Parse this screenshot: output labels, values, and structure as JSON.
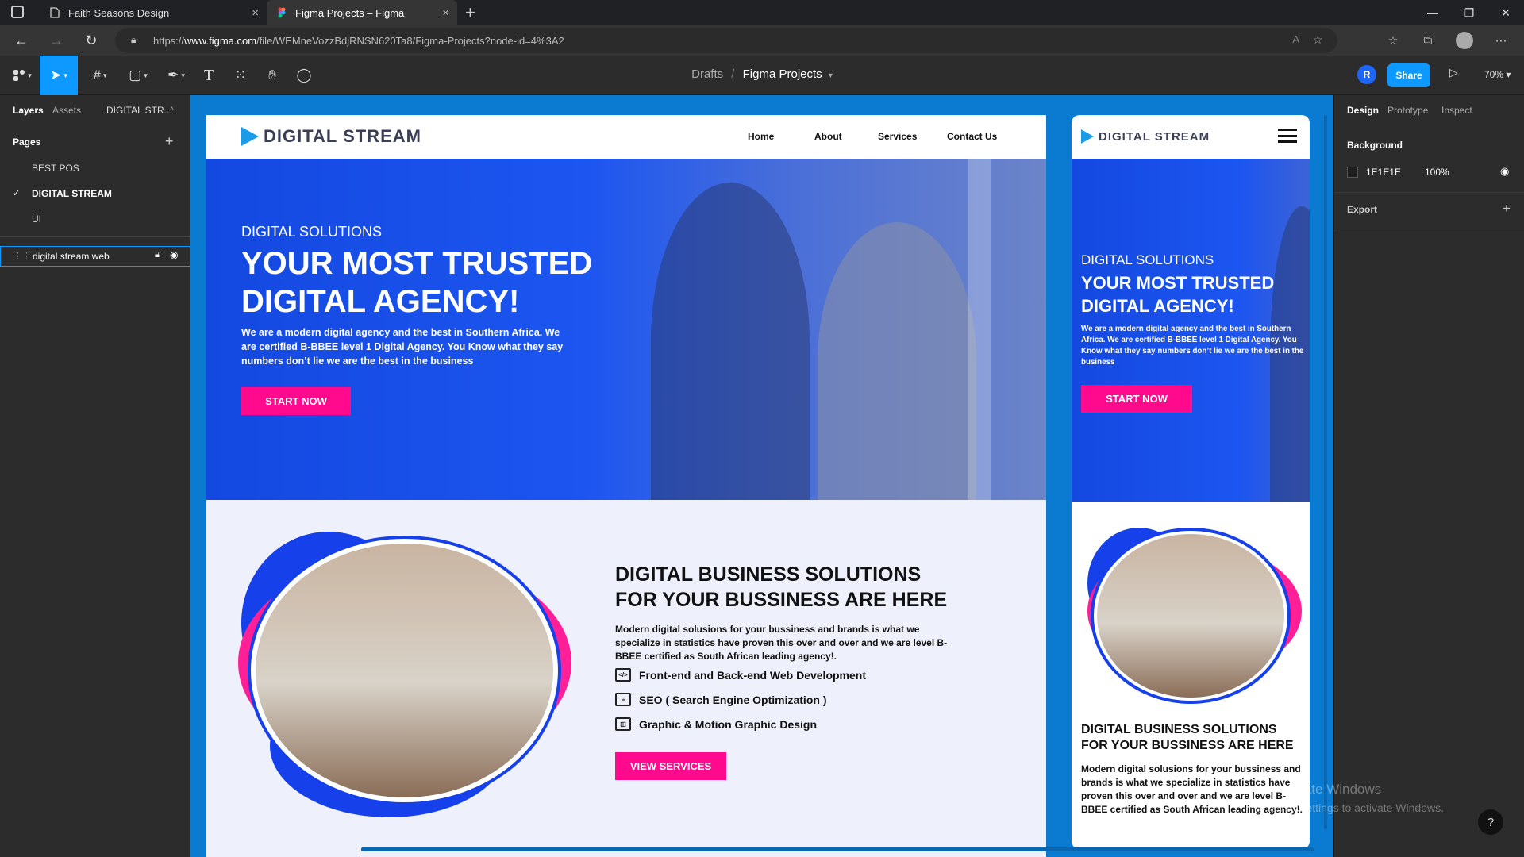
{
  "browser": {
    "tabs": [
      {
        "title": "Faith Seasons Design",
        "close": "×"
      },
      {
        "title": "Figma Projects – Figma",
        "close": "×"
      }
    ],
    "new_tab": "+",
    "url_prefix": "https://",
    "url_domain": "www.figma.com",
    "url_path": "/file/WEMneVozzBdjRNSN620Ta8/Figma-Projects?node-id=4%3A2",
    "window_controls": [
      "—",
      "❐",
      "✕"
    ]
  },
  "figma_toolbar": {
    "breadcrumb_parent": "Drafts",
    "breadcrumb_sep": "/",
    "breadcrumb_current": "Figma Projects",
    "avatar_initial": "R",
    "share_label": "Share",
    "zoom": "70%"
  },
  "left_panel": {
    "tabs": [
      "Layers",
      "Assets",
      "DIGITAL STR..."
    ],
    "pages_heading": "Pages",
    "pages": [
      "BEST POS",
      "DIGITAL STREAM",
      "UI"
    ],
    "selected_page": "DIGITAL STREAM",
    "layer_name": "digital stream web"
  },
  "right_panel": {
    "tabs": [
      "Design",
      "Prototype",
      "Inspect"
    ],
    "background_heading": "Background",
    "background_hex": "1E1E1E",
    "background_opacity": "100%",
    "export_heading": "Export"
  },
  "desktop": {
    "logo_text": "DIGITAL STREAM",
    "nav": [
      "Home",
      "About",
      "Services",
      "Contact Us"
    ],
    "hero_eyebrow": "DIGITAL SOLUTIONS",
    "hero_title_1": "YOUR MOST TRUSTED",
    "hero_title_2": "DIGITAL AGENCY!",
    "hero_body": "We are a modern digital agency and the best in Southern Africa. We are certified B-BBEE level 1 Digital Agency. You Know what they say numbers don’t lie we are the best in the business",
    "hero_cta": "START NOW",
    "sec_title_1": "DIGITAL BUSINESS SOLUTIONS",
    "sec_title_2": "FOR YOUR BUSSINESS ARE HERE",
    "sec_body": "Modern digital solusions for your bussiness and brands is what we specialize in statistics have proven this over and over and we are level B-BBEE certified as South African leading agency!.",
    "services": [
      "Front-end and Back-end Web Development",
      "SEO ( Search Engine Optimization )",
      "Graphic & Motion Graphic Design"
    ],
    "sec_cta": "VIEW SERVICES"
  },
  "mobile": {
    "logo_text": "DIGITAL STREAM",
    "hero_eyebrow": "DIGITAL SOLUTIONS",
    "hero_title_1": "YOUR MOST TRUSTED",
    "hero_title_2": "DIGITAL AGENCY!",
    "hero_body": "We are a modern digital agency and the best in Southern Africa. We are certified B-BBEE level 1 Digital Agency. You Know what they say numbers don’t lie we are the best in the business",
    "hero_cta": "START NOW",
    "sec_title_1": "DIGITAL BUSINESS SOLUTIONS",
    "sec_title_2": "FOR YOUR BUSSINESS ARE HERE",
    "sec_body": "Modern digital solusions for your bussiness and brands is what we specialize in statistics have proven this over and over and we are level B-BBEE certified as South African leading agency!."
  },
  "watermark": {
    "line1": "Activate Windows",
    "line2": "Go to Settings to activate Windows."
  },
  "help": "?",
  "colors": {
    "figma_blue": "#0d99ff",
    "hero_blue": "#1c55f0",
    "accent_pink": "#ff0a8c",
    "canvas_bg": "#0b7bd1"
  }
}
